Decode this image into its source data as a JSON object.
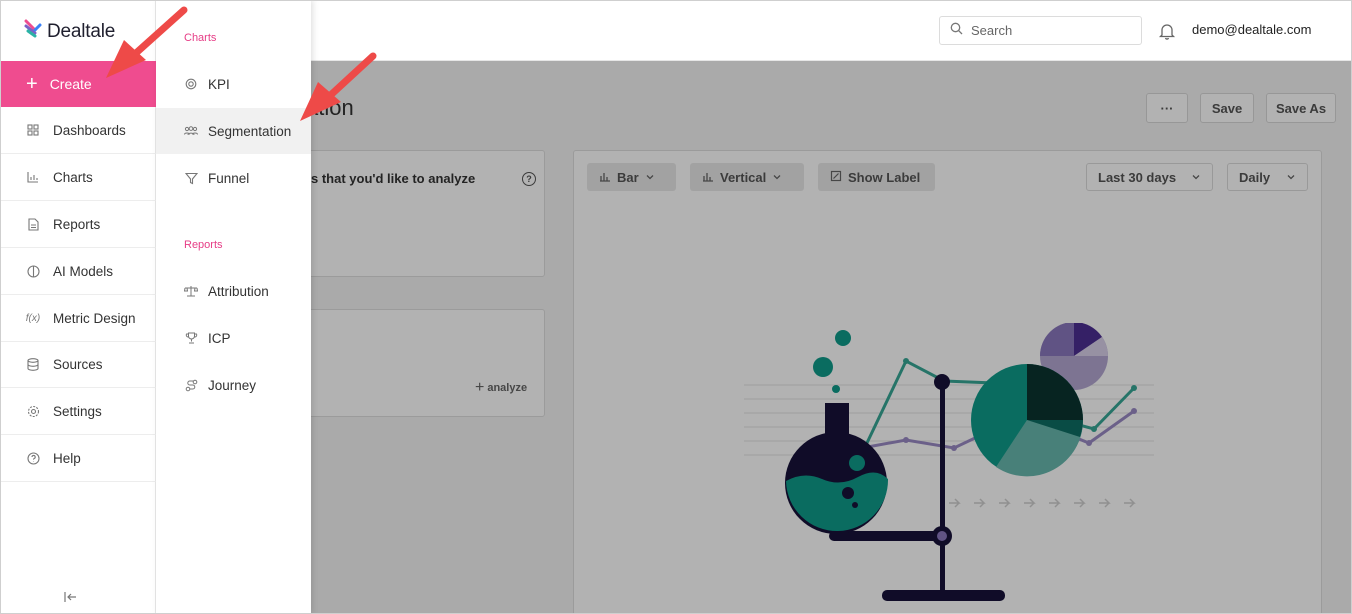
{
  "app": {
    "name": "Dealtale"
  },
  "header": {
    "search_placeholder": "Search",
    "user_email": "demo@dealtale.com"
  },
  "sidebar": {
    "create_label": "Create",
    "items": [
      {
        "label": "Dashboards",
        "icon": "grid-icon"
      },
      {
        "label": "Charts",
        "icon": "bar-chart-icon"
      },
      {
        "label": "Reports",
        "icon": "document-icon"
      },
      {
        "label": "AI Models",
        "icon": "brain-icon"
      },
      {
        "label": "Metric Design",
        "icon": "function-icon"
      },
      {
        "label": "Sources",
        "icon": "database-icon"
      },
      {
        "label": "Settings",
        "icon": "gear-icon"
      },
      {
        "label": "Help",
        "icon": "help-circle-icon"
      }
    ]
  },
  "dropdown": {
    "charts_heading": "Charts",
    "charts_items": [
      {
        "label": "KPI",
        "icon": "target-icon"
      },
      {
        "label": "Segmentation",
        "icon": "people-icon"
      },
      {
        "label": "Funnel",
        "icon": "funnel-icon"
      }
    ],
    "reports_heading": "Reports",
    "reports_items": [
      {
        "label": "Attribution",
        "icon": "scale-icon"
      },
      {
        "label": "ICP",
        "icon": "trophy-icon"
      },
      {
        "label": "Journey",
        "icon": "route-icon"
      }
    ]
  },
  "main": {
    "title_visible": "ation",
    "more_label": "···",
    "save_label": "Save",
    "save_as_label": "Save As",
    "card1_text": "s that you'd like to analyze",
    "analyze_label": "analyze",
    "chart_type": "Bar",
    "orientation": "Vertical",
    "show_label": "Show Label",
    "date_range": "Last 30 days",
    "granularity": "Daily"
  },
  "colors": {
    "accent_pink": "#ef4c8f",
    "teal": "#0f9b8a",
    "purple": "#5b3ea0",
    "navy": "#17123a"
  }
}
